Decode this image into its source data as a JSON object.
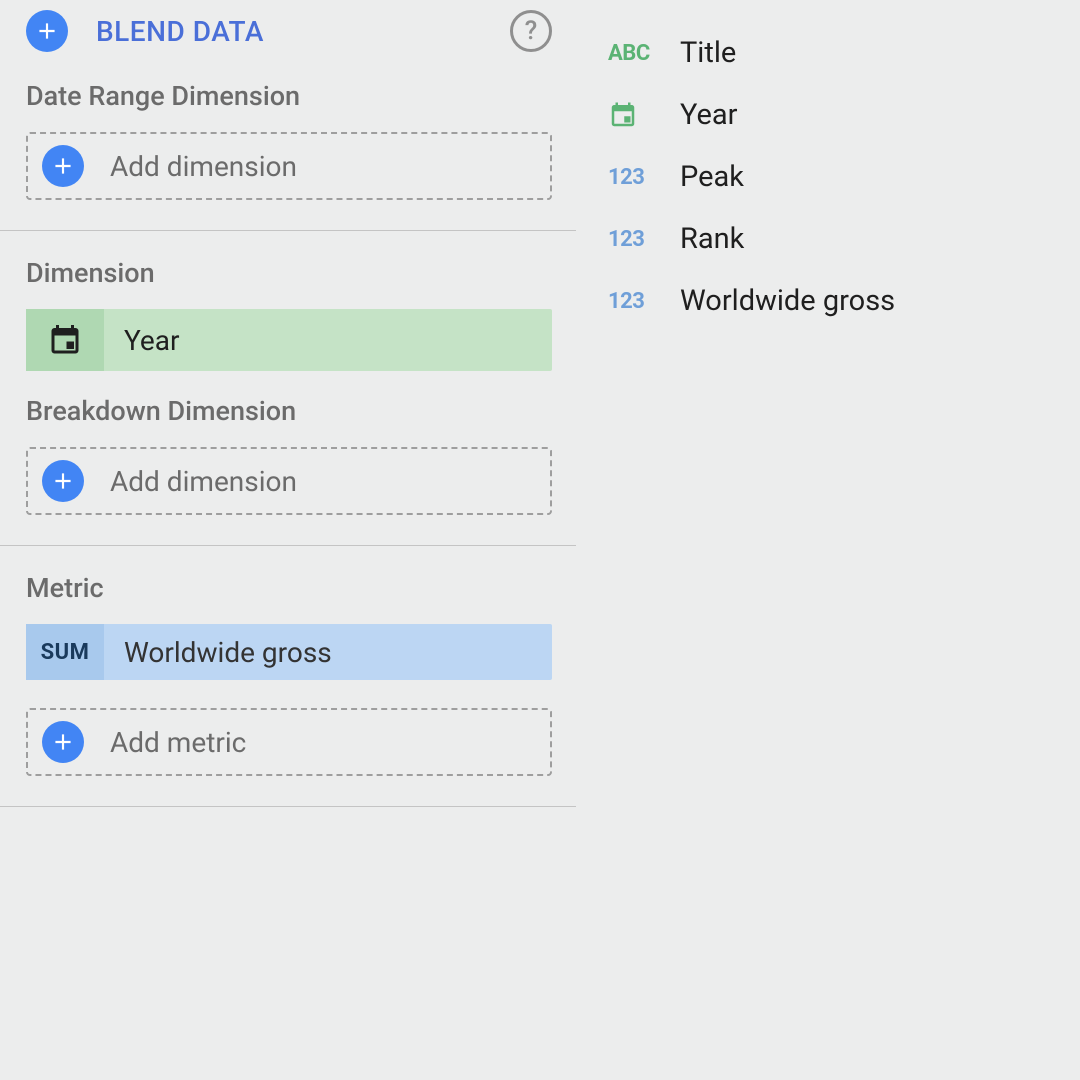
{
  "config": {
    "blend_label": "BLEND DATA",
    "date_range_dimension": {
      "label": "Date Range Dimension",
      "add_label": "Add dimension"
    },
    "dimension": {
      "label": "Dimension",
      "items": [
        {
          "label": "Year",
          "type": "date"
        }
      ],
      "breakdown_label": "Breakdown Dimension",
      "add_label": "Add dimension"
    },
    "metric": {
      "label": "Metric",
      "items": [
        {
          "label": "Worldwide gross",
          "agg": "SUM"
        }
      ],
      "add_label": "Add metric"
    }
  },
  "fields": [
    {
      "label": "Title",
      "type": "abc"
    },
    {
      "label": "Year",
      "type": "date"
    },
    {
      "label": "Peak",
      "type": "123"
    },
    {
      "label": "Rank",
      "type": "123"
    },
    {
      "label": "Worldwide gross",
      "type": "123"
    }
  ]
}
